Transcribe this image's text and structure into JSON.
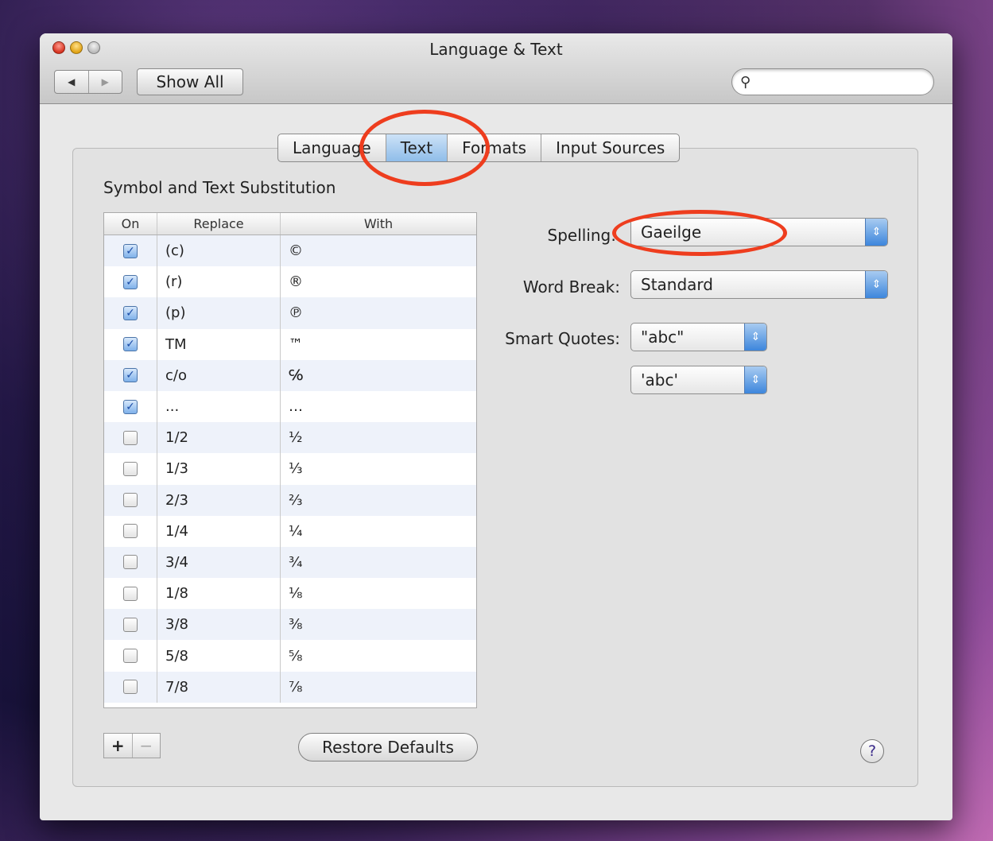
{
  "window": {
    "title": "Language & Text"
  },
  "toolbar": {
    "show_all": "Show All",
    "search_placeholder": ""
  },
  "tabs": [
    "Language",
    "Text",
    "Formats",
    "Input Sources"
  ],
  "active_tab": "Text",
  "section": {
    "title": "Symbol and Text Substitution"
  },
  "table": {
    "headers": {
      "on": "On",
      "replace": "Replace",
      "with": "With"
    },
    "rows": [
      {
        "on": true,
        "replace": "(c)",
        "with": "©"
      },
      {
        "on": true,
        "replace": "(r)",
        "with": "®"
      },
      {
        "on": true,
        "replace": "(p)",
        "with": "℗"
      },
      {
        "on": true,
        "replace": "TM",
        "with": "™"
      },
      {
        "on": true,
        "replace": "c/o",
        "with": "℅"
      },
      {
        "on": true,
        "replace": "...",
        "with": "…"
      },
      {
        "on": false,
        "replace": "1/2",
        "with": "½"
      },
      {
        "on": false,
        "replace": "1/3",
        "with": "⅓"
      },
      {
        "on": false,
        "replace": "2/3",
        "with": "⅔"
      },
      {
        "on": false,
        "replace": "1/4",
        "with": "¼"
      },
      {
        "on": false,
        "replace": "3/4",
        "with": "¾"
      },
      {
        "on": false,
        "replace": "1/8",
        "with": "⅛"
      },
      {
        "on": false,
        "replace": "3/8",
        "with": "⅜"
      },
      {
        "on": false,
        "replace": "5/8",
        "with": "⅝"
      },
      {
        "on": false,
        "replace": "7/8",
        "with": "⅞"
      }
    ]
  },
  "buttons": {
    "plus": "+",
    "minus": "−",
    "restore": "Restore Defaults",
    "help": "?"
  },
  "settings": {
    "spelling_label": "Spelling:",
    "spelling_value": "Gaeilge",
    "wordbreak_label": "Word Break:",
    "wordbreak_value": "Standard",
    "quotes_label": "Smart Quotes:",
    "double_quotes_value": "\"abc\"",
    "single_quotes_value": "'abc'"
  },
  "icons": {
    "back": "◀",
    "forward": "▶",
    "search": "⚲",
    "stepper": "⇕",
    "check": "✓"
  },
  "annotation_color": "#ee3d1e"
}
